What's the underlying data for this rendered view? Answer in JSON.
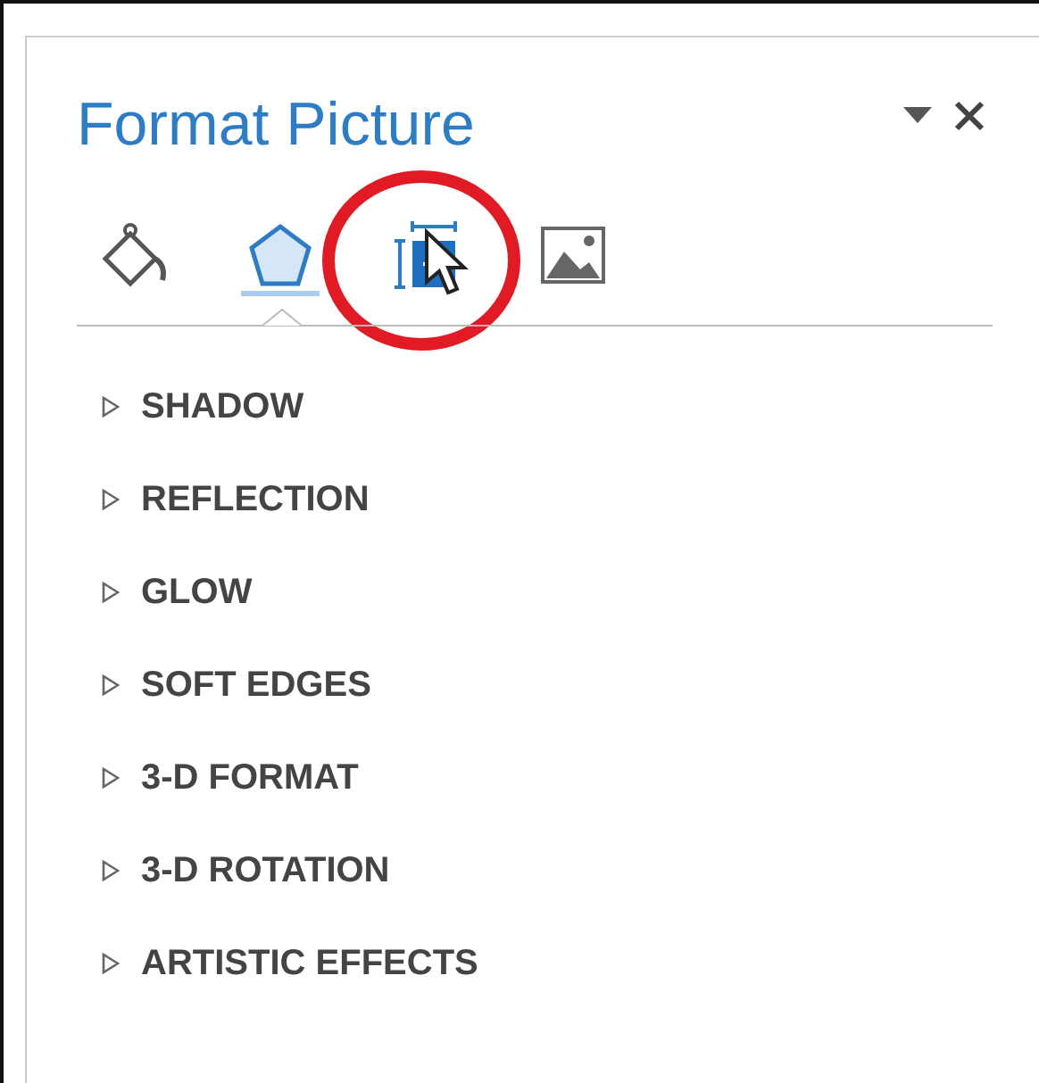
{
  "pane": {
    "title": "Format Picture"
  },
  "tabs": [
    {
      "kind": "fill",
      "selected": false
    },
    {
      "kind": "effects",
      "selected": true
    },
    {
      "kind": "layout",
      "selected": false,
      "highlighted": true
    },
    {
      "kind": "picture",
      "selected": false
    }
  ],
  "sections": [
    {
      "label": "SHADOW",
      "expanded": false
    },
    {
      "label": "REFLECTION",
      "expanded": false
    },
    {
      "label": "GLOW",
      "expanded": false
    },
    {
      "label": "SOFT EDGES",
      "expanded": false
    },
    {
      "label": "3-D FORMAT",
      "expanded": false
    },
    {
      "label": "3-D ROTATION",
      "expanded": false
    },
    {
      "label": "ARTISTIC EFFECTS",
      "expanded": false
    }
  ]
}
